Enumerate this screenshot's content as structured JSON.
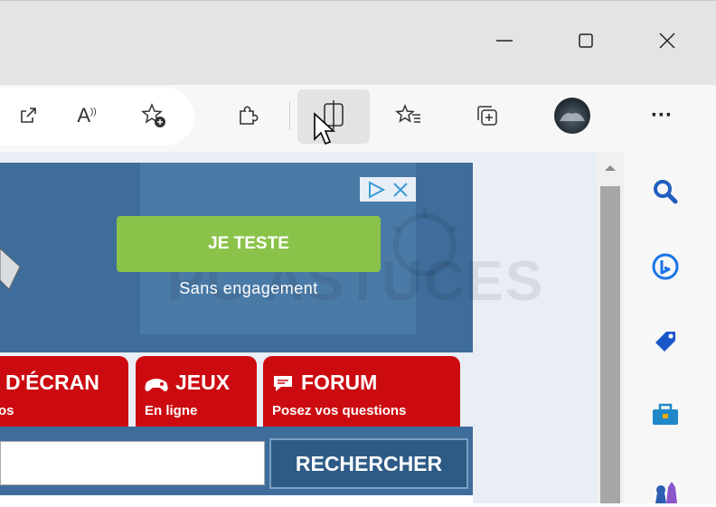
{
  "window": {
    "minimize_icon": "minimize-icon",
    "maximize_icon": "maximize-icon",
    "close_icon": "close-icon"
  },
  "toolbar": {
    "read_aloud_label": "A",
    "more_label": "···"
  },
  "ad": {
    "button_label": "JE TESTE",
    "subtitle": "Sans engagement",
    "watermark": "PC ASTUCES"
  },
  "nav": {
    "tabs": [
      {
        "title": "D'ÉCRAN",
        "subtitle": "os"
      },
      {
        "title": "JEUX",
        "subtitle": "En ligne"
      },
      {
        "title": "FORUM",
        "subtitle": "Posez vos questions"
      }
    ]
  },
  "search": {
    "placeholder": "",
    "button_label": "RECHERCHER"
  },
  "colors": {
    "accent_red": "#cc0b10",
    "banner_blue": "#3e6d9b",
    "ad_green": "#8bc34a"
  }
}
